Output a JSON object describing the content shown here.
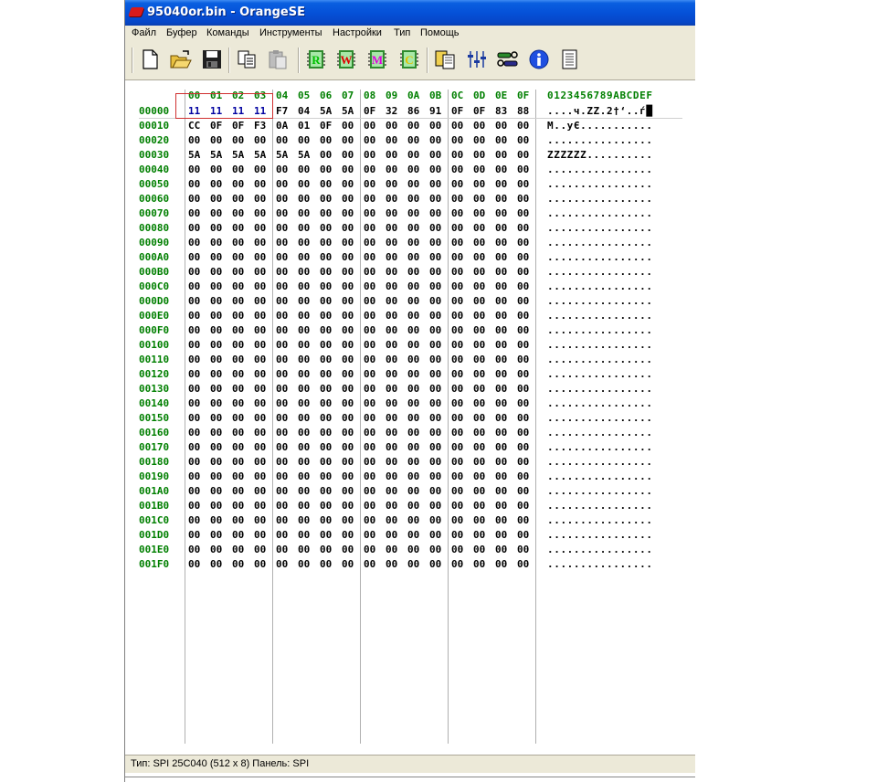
{
  "window": {
    "title": "95040or.bin - OrangeSE"
  },
  "menu": [
    "Файл",
    "Буфер",
    "Команды",
    "Инструменты",
    "Настройки",
    "Тип",
    "Помощь"
  ],
  "toolbar": {
    "buttons": [
      {
        "name": "new-file-icon"
      },
      {
        "name": "open-folder-icon"
      },
      {
        "name": "save-disk-icon"
      },
      {
        "name": "copy-icon"
      },
      {
        "name": "paste-icon"
      },
      {
        "name": "read-chip-icon",
        "letter": "R",
        "color": "#00c000"
      },
      {
        "name": "write-chip-icon",
        "letter": "W",
        "color": "#e00000"
      },
      {
        "name": "memory-chip-icon",
        "letter": "M",
        "color": "#e000e0"
      },
      {
        "name": "compare-chip-icon",
        "letter": "C",
        "color": "#e0c000"
      },
      {
        "name": "clipboard-chip-icon"
      },
      {
        "name": "equalizer-icon"
      },
      {
        "name": "tools-icon"
      },
      {
        "name": "info-icon"
      },
      {
        "name": "notes-icon"
      }
    ]
  },
  "hex": {
    "columns": [
      "00",
      "01",
      "02",
      "03",
      "04",
      "05",
      "06",
      "07",
      "08",
      "09",
      "0A",
      "0B",
      "0C",
      "0D",
      "0E",
      "0F"
    ],
    "ascii_header": "0123456789ABCDEF",
    "rows": [
      {
        "addr": "00000",
        "bytes": [
          "11",
          "11",
          "11",
          "11",
          "F7",
          "04",
          "5A",
          "5A",
          "0F",
          "32",
          "86",
          "91",
          "0F",
          "0F",
          "83",
          "88"
        ],
        "ascii": "....ч.ZZ.2†‘..ѓ█"
      },
      {
        "addr": "00010",
        "bytes": [
          "CC",
          "0F",
          "0F",
          "F3",
          "0A",
          "01",
          "0F",
          "00",
          "00",
          "00",
          "00",
          "00",
          "00",
          "00",
          "00",
          "00"
        ],
        "ascii": "M..уЄ..........."
      },
      {
        "addr": "00020",
        "bytes": [
          "00",
          "00",
          "00",
          "00",
          "00",
          "00",
          "00",
          "00",
          "00",
          "00",
          "00",
          "00",
          "00",
          "00",
          "00",
          "00"
        ],
        "ascii": "................"
      },
      {
        "addr": "00030",
        "bytes": [
          "5A",
          "5A",
          "5A",
          "5A",
          "5A",
          "5A",
          "00",
          "00",
          "00",
          "00",
          "00",
          "00",
          "00",
          "00",
          "00",
          "00"
        ],
        "ascii": "ZZZZZZ.........."
      },
      {
        "addr": "00040",
        "bytes": [
          "00",
          "00",
          "00",
          "00",
          "00",
          "00",
          "00",
          "00",
          "00",
          "00",
          "00",
          "00",
          "00",
          "00",
          "00",
          "00"
        ],
        "ascii": "................"
      },
      {
        "addr": "00050",
        "bytes": [
          "00",
          "00",
          "00",
          "00",
          "00",
          "00",
          "00",
          "00",
          "00",
          "00",
          "00",
          "00",
          "00",
          "00",
          "00",
          "00"
        ],
        "ascii": "................"
      },
      {
        "addr": "00060",
        "bytes": [
          "00",
          "00",
          "00",
          "00",
          "00",
          "00",
          "00",
          "00",
          "00",
          "00",
          "00",
          "00",
          "00",
          "00",
          "00",
          "00"
        ],
        "ascii": "................"
      },
      {
        "addr": "00070",
        "bytes": [
          "00",
          "00",
          "00",
          "00",
          "00",
          "00",
          "00",
          "00",
          "00",
          "00",
          "00",
          "00",
          "00",
          "00",
          "00",
          "00"
        ],
        "ascii": "................"
      },
      {
        "addr": "00080",
        "bytes": [
          "00",
          "00",
          "00",
          "00",
          "00",
          "00",
          "00",
          "00",
          "00",
          "00",
          "00",
          "00",
          "00",
          "00",
          "00",
          "00"
        ],
        "ascii": "................"
      },
      {
        "addr": "00090",
        "bytes": [
          "00",
          "00",
          "00",
          "00",
          "00",
          "00",
          "00",
          "00",
          "00",
          "00",
          "00",
          "00",
          "00",
          "00",
          "00",
          "00"
        ],
        "ascii": "................"
      },
      {
        "addr": "000A0",
        "bytes": [
          "00",
          "00",
          "00",
          "00",
          "00",
          "00",
          "00",
          "00",
          "00",
          "00",
          "00",
          "00",
          "00",
          "00",
          "00",
          "00"
        ],
        "ascii": "................"
      },
      {
        "addr": "000B0",
        "bytes": [
          "00",
          "00",
          "00",
          "00",
          "00",
          "00",
          "00",
          "00",
          "00",
          "00",
          "00",
          "00",
          "00",
          "00",
          "00",
          "00"
        ],
        "ascii": "................"
      },
      {
        "addr": "000C0",
        "bytes": [
          "00",
          "00",
          "00",
          "00",
          "00",
          "00",
          "00",
          "00",
          "00",
          "00",
          "00",
          "00",
          "00",
          "00",
          "00",
          "00"
        ],
        "ascii": "................"
      },
      {
        "addr": "000D0",
        "bytes": [
          "00",
          "00",
          "00",
          "00",
          "00",
          "00",
          "00",
          "00",
          "00",
          "00",
          "00",
          "00",
          "00",
          "00",
          "00",
          "00"
        ],
        "ascii": "................"
      },
      {
        "addr": "000E0",
        "bytes": [
          "00",
          "00",
          "00",
          "00",
          "00",
          "00",
          "00",
          "00",
          "00",
          "00",
          "00",
          "00",
          "00",
          "00",
          "00",
          "00"
        ],
        "ascii": "................"
      },
      {
        "addr": "000F0",
        "bytes": [
          "00",
          "00",
          "00",
          "00",
          "00",
          "00",
          "00",
          "00",
          "00",
          "00",
          "00",
          "00",
          "00",
          "00",
          "00",
          "00"
        ],
        "ascii": "................"
      },
      {
        "addr": "00100",
        "bytes": [
          "00",
          "00",
          "00",
          "00",
          "00",
          "00",
          "00",
          "00",
          "00",
          "00",
          "00",
          "00",
          "00",
          "00",
          "00",
          "00"
        ],
        "ascii": "................"
      },
      {
        "addr": "00110",
        "bytes": [
          "00",
          "00",
          "00",
          "00",
          "00",
          "00",
          "00",
          "00",
          "00",
          "00",
          "00",
          "00",
          "00",
          "00",
          "00",
          "00"
        ],
        "ascii": "................"
      },
      {
        "addr": "00120",
        "bytes": [
          "00",
          "00",
          "00",
          "00",
          "00",
          "00",
          "00",
          "00",
          "00",
          "00",
          "00",
          "00",
          "00",
          "00",
          "00",
          "00"
        ],
        "ascii": "................"
      },
      {
        "addr": "00130",
        "bytes": [
          "00",
          "00",
          "00",
          "00",
          "00",
          "00",
          "00",
          "00",
          "00",
          "00",
          "00",
          "00",
          "00",
          "00",
          "00",
          "00"
        ],
        "ascii": "................"
      },
      {
        "addr": "00140",
        "bytes": [
          "00",
          "00",
          "00",
          "00",
          "00",
          "00",
          "00",
          "00",
          "00",
          "00",
          "00",
          "00",
          "00",
          "00",
          "00",
          "00"
        ],
        "ascii": "................"
      },
      {
        "addr": "00150",
        "bytes": [
          "00",
          "00",
          "00",
          "00",
          "00",
          "00",
          "00",
          "00",
          "00",
          "00",
          "00",
          "00",
          "00",
          "00",
          "00",
          "00"
        ],
        "ascii": "................"
      },
      {
        "addr": "00160",
        "bytes": [
          "00",
          "00",
          "00",
          "00",
          "00",
          "00",
          "00",
          "00",
          "00",
          "00",
          "00",
          "00",
          "00",
          "00",
          "00",
          "00"
        ],
        "ascii": "................"
      },
      {
        "addr": "00170",
        "bytes": [
          "00",
          "00",
          "00",
          "00",
          "00",
          "00",
          "00",
          "00",
          "00",
          "00",
          "00",
          "00",
          "00",
          "00",
          "00",
          "00"
        ],
        "ascii": "................"
      },
      {
        "addr": "00180",
        "bytes": [
          "00",
          "00",
          "00",
          "00",
          "00",
          "00",
          "00",
          "00",
          "00",
          "00",
          "00",
          "00",
          "00",
          "00",
          "00",
          "00"
        ],
        "ascii": "................"
      },
      {
        "addr": "00190",
        "bytes": [
          "00",
          "00",
          "00",
          "00",
          "00",
          "00",
          "00",
          "00",
          "00",
          "00",
          "00",
          "00",
          "00",
          "00",
          "00",
          "00"
        ],
        "ascii": "................"
      },
      {
        "addr": "001A0",
        "bytes": [
          "00",
          "00",
          "00",
          "00",
          "00",
          "00",
          "00",
          "00",
          "00",
          "00",
          "00",
          "00",
          "00",
          "00",
          "00",
          "00"
        ],
        "ascii": "................"
      },
      {
        "addr": "001B0",
        "bytes": [
          "00",
          "00",
          "00",
          "00",
          "00",
          "00",
          "00",
          "00",
          "00",
          "00",
          "00",
          "00",
          "00",
          "00",
          "00",
          "00"
        ],
        "ascii": "................"
      },
      {
        "addr": "001C0",
        "bytes": [
          "00",
          "00",
          "00",
          "00",
          "00",
          "00",
          "00",
          "00",
          "00",
          "00",
          "00",
          "00",
          "00",
          "00",
          "00",
          "00"
        ],
        "ascii": "................"
      },
      {
        "addr": "001D0",
        "bytes": [
          "00",
          "00",
          "00",
          "00",
          "00",
          "00",
          "00",
          "00",
          "00",
          "00",
          "00",
          "00",
          "00",
          "00",
          "00",
          "00"
        ],
        "ascii": "................"
      },
      {
        "addr": "001E0",
        "bytes": [
          "00",
          "00",
          "00",
          "00",
          "00",
          "00",
          "00",
          "00",
          "00",
          "00",
          "00",
          "00",
          "00",
          "00",
          "00",
          "00"
        ],
        "ascii": "................"
      },
      {
        "addr": "001F0",
        "bytes": [
          "00",
          "00",
          "00",
          "00",
          "00",
          "00",
          "00",
          "00",
          "00",
          "00",
          "00",
          "00",
          "00",
          "00",
          "00",
          "00"
        ],
        "ascii": "................"
      }
    ],
    "selection": {
      "row": 0,
      "from": 0,
      "to": 3
    }
  },
  "status": {
    "text": "Тип: SPI 25C040 (512 x 8)   Панель: SPI"
  },
  "colors": {
    "title_bar": "#0551d8",
    "chrome": "#ece9d8",
    "address": "#007f00",
    "selected_bytes": "#0000a0",
    "selection_frame": "#d03030"
  }
}
